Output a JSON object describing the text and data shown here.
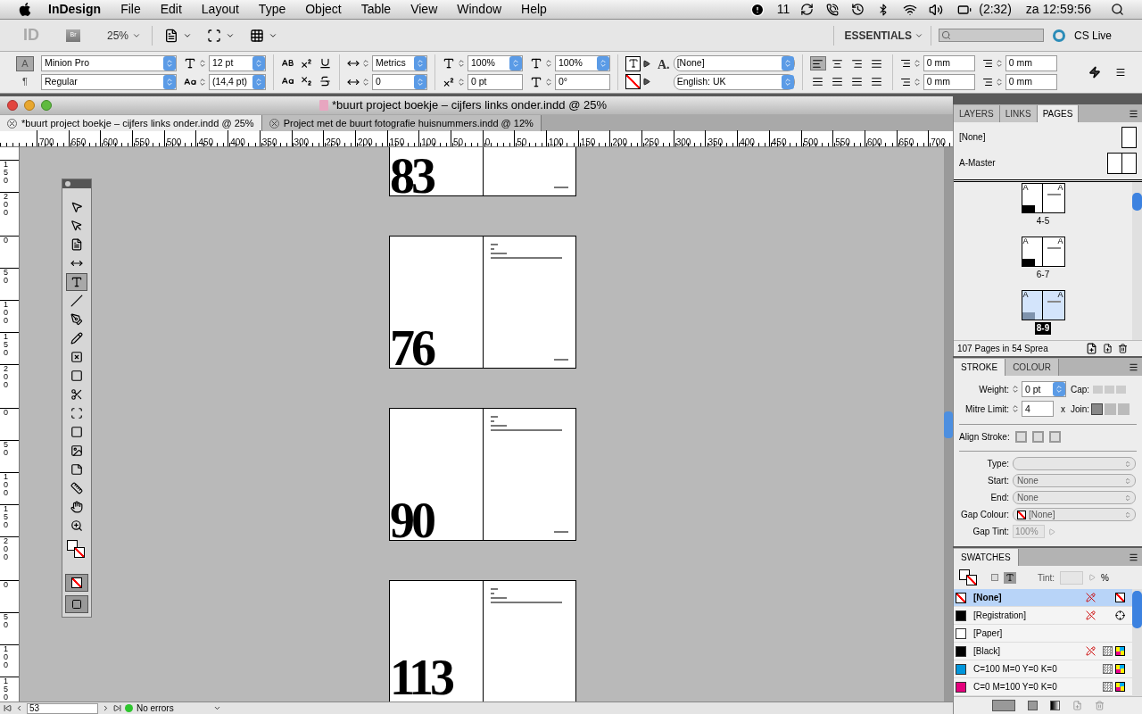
{
  "menu_bar": {
    "app": "InDesign",
    "menus": [
      "File",
      "Edit",
      "Layout",
      "Type",
      "Object",
      "Table",
      "View",
      "Window",
      "Help"
    ],
    "adobe_count": "11",
    "battery": "(2:32)",
    "clock": "za 12:59:56"
  },
  "app_bar": {
    "logo": "ID",
    "bridge": "Br",
    "zoom": "25%",
    "workspace": "ESSENTIALS",
    "cs_live": "CS Live"
  },
  "control_panel": {
    "character_mode": true,
    "character_mode_label": "A",
    "paragraph_mode_label": "¶",
    "char_style_glyph": "A.",
    "font_family": "Minion Pro",
    "font_style": "Regular",
    "font_size": "12 pt",
    "leading": "(14,4 pt)",
    "kerning": "Metrics",
    "tracking": "0",
    "vertical_scale": "100%",
    "baseline_shift": "0 pt",
    "horizontal_scale": "100%",
    "skew": "0°",
    "char_style": "[None]",
    "language": "English: UK",
    "alignments": [
      {
        "selected": true
      },
      {
        "selected": false
      },
      {
        "selected": false
      },
      {
        "selected": false
      },
      {
        "selected": false
      },
      {
        "selected": false
      },
      {
        "selected": false
      },
      {
        "selected": false
      }
    ],
    "indents": [
      "0 mm",
      "0 mm",
      "0 mm",
      "0 mm"
    ]
  },
  "document": {
    "title": "*buurt project boekje – cijfers links onder.indd @ 25%",
    "tabs": [
      {
        "label": "*buurt project boekje – cijfers links onder.indd @ 25%",
        "selected": true
      },
      {
        "label": "Project met de buurt fotografie huisnummers.indd @ 12%",
        "selected": false
      }
    ],
    "ruler_labels": [
      "700",
      "650",
      "600",
      "550",
      "500",
      "450",
      "400",
      "350",
      "300",
      "250",
      "200",
      "150",
      "100",
      "50",
      "0",
      "50",
      "100",
      "150",
      "200",
      "250",
      "300",
      "350",
      "400",
      "450",
      "500",
      "550",
      "600",
      "650",
      "700"
    ],
    "spreads": [
      {
        "number": "83",
        "ruler_labels": [
          "150",
          "200"
        ]
      },
      {
        "number": "76",
        "ruler_labels": [
          "0",
          "50",
          "100",
          "150",
          "200"
        ]
      },
      {
        "number": "90",
        "ruler_labels": [
          "0",
          "50",
          "100",
          "150",
          "200"
        ]
      },
      {
        "number": "113",
        "ruler_labels": [
          "0",
          "50",
          "100",
          "150"
        ]
      }
    ],
    "tools": [
      {
        "selected": false
      },
      {
        "selected": false
      },
      {
        "selected": false
      },
      {
        "selected": false
      },
      {
        "selected": true
      },
      {
        "selected": false
      },
      {
        "selected": false
      },
      {
        "selected": false
      },
      {
        "selected": false
      },
      {
        "selected": false
      },
      {
        "selected": false
      },
      {
        "selected": false
      },
      {
        "selected": false
      },
      {
        "selected": false
      },
      {
        "selected": false
      },
      {
        "selected": false
      },
      {
        "selected": false
      },
      {
        "selected": false
      }
    ],
    "status": {
      "page": "53",
      "preflight": "No errors"
    }
  },
  "pages_panel": {
    "tabs": [
      {
        "label": "LAYERS",
        "selected": false
      },
      {
        "label": "LINKS",
        "selected": false
      },
      {
        "label": "PAGES",
        "selected": true
      }
    ],
    "masters": [
      "[None]",
      "A-Master"
    ],
    "spreads": [
      {
        "label": "4-5",
        "left_master": "A",
        "right_master": "A",
        "selected": false
      },
      {
        "label": "6-7",
        "left_master": "A",
        "right_master": "A",
        "selected": false
      },
      {
        "label": "8-9",
        "left_master": "A",
        "right_master": "A",
        "selected": true
      }
    ],
    "footer": "107 Pages in 54 Sprea"
  },
  "stroke_panel": {
    "tabs": [
      {
        "label": "STROKE",
        "selected": true
      },
      {
        "label": "COLOUR",
        "selected": false
      }
    ],
    "weight_label": "Weight:",
    "weight": "0 pt",
    "cap_label": "Cap:",
    "mitre_label": "Mitre Limit:",
    "mitre": "4",
    "mitre_unit": "x",
    "join_label": "Join:",
    "align_label": "Align Stroke:",
    "type_label": "Type:",
    "start_label": "Start:",
    "start": "None",
    "end_label": "End:",
    "end": "None",
    "gap_colour_label": "Gap Colour:",
    "gap_colour": "[None]",
    "gap_tint_label": "Gap Tint:",
    "gap_tint": "100%"
  },
  "swatches_panel": {
    "title": "SWATCHES",
    "tint_label": "Tint:",
    "percent": "%",
    "swatches": [
      {
        "name": "[None]",
        "kind": "none",
        "selected": true
      },
      {
        "name": "[Registration]",
        "kind": "registration",
        "color": "#000000",
        "selected": false
      },
      {
        "name": "[Paper]",
        "kind": "paper",
        "color": "#ffffff",
        "selected": false
      },
      {
        "name": "[Black]",
        "kind": "black",
        "color": "#000000",
        "selected": false
      },
      {
        "name": "C=100 M=0 Y=0 K=0",
        "kind": "process",
        "color": "#0096dc",
        "selected": false
      },
      {
        "name": "C=0 M=100 Y=0 K=0",
        "kind": "process",
        "color": "#e4007c",
        "selected": false
      }
    ]
  }
}
